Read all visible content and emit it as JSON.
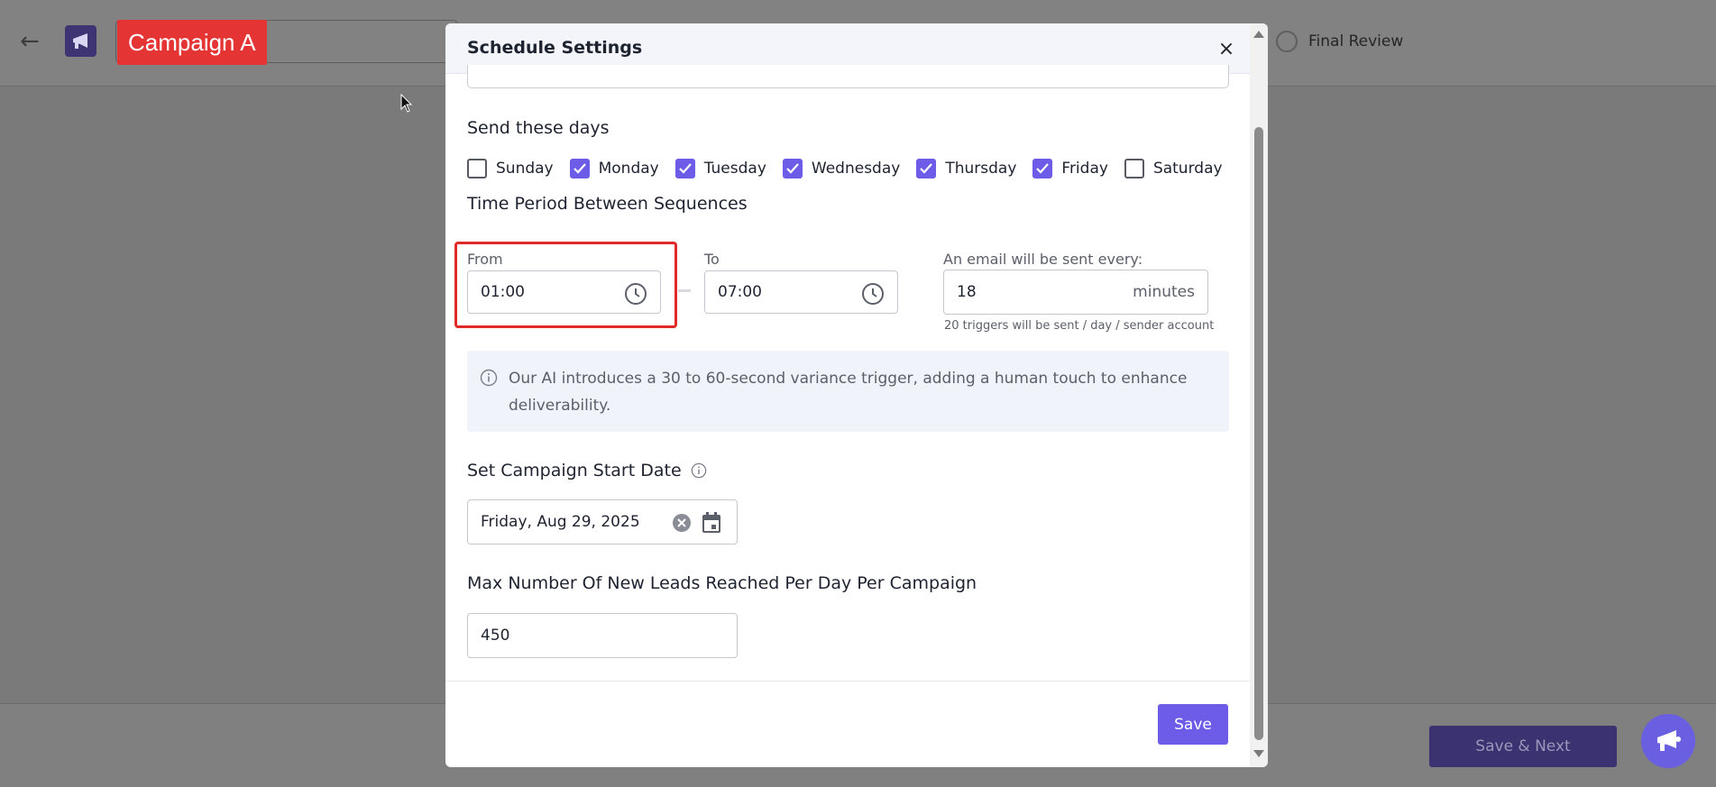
{
  "background": {
    "campaign_tag": "Campaign A",
    "final_step_label": "Final Review",
    "save_next_label": "Save & Next"
  },
  "modal": {
    "title": "Schedule Settings",
    "close_label": "×",
    "days_heading": "Send these days",
    "days": [
      {
        "label": "Sunday",
        "checked": false
      },
      {
        "label": "Monday",
        "checked": true
      },
      {
        "label": "Tuesday",
        "checked": true
      },
      {
        "label": "Wednesday",
        "checked": true
      },
      {
        "label": "Thursday",
        "checked": true
      },
      {
        "label": "Friday",
        "checked": true
      },
      {
        "label": "Saturday",
        "checked": false
      }
    ],
    "time_heading": "Time Period Between Sequences",
    "from_label": "From",
    "from_value": "01:00",
    "to_label": "To",
    "to_value": "07:00",
    "interval_label": "An email will be sent every:",
    "interval_value": "18",
    "interval_unit": "minutes",
    "interval_hint": "20 triggers will be sent / day / sender account",
    "info_text": "Our AI introduces a 30 to 60-second variance trigger, adding a human touch to enhance deliverability.",
    "start_date_heading": "Set Campaign Start Date",
    "start_date_value": "Friday, Aug 29, 2025",
    "leads_heading": "Max Number Of New Leads Reached Per Day Per Campaign",
    "leads_value": "450",
    "save_label": "Save"
  },
  "colors": {
    "accent": "#6c5ce7",
    "highlight": "#e02a2a"
  }
}
